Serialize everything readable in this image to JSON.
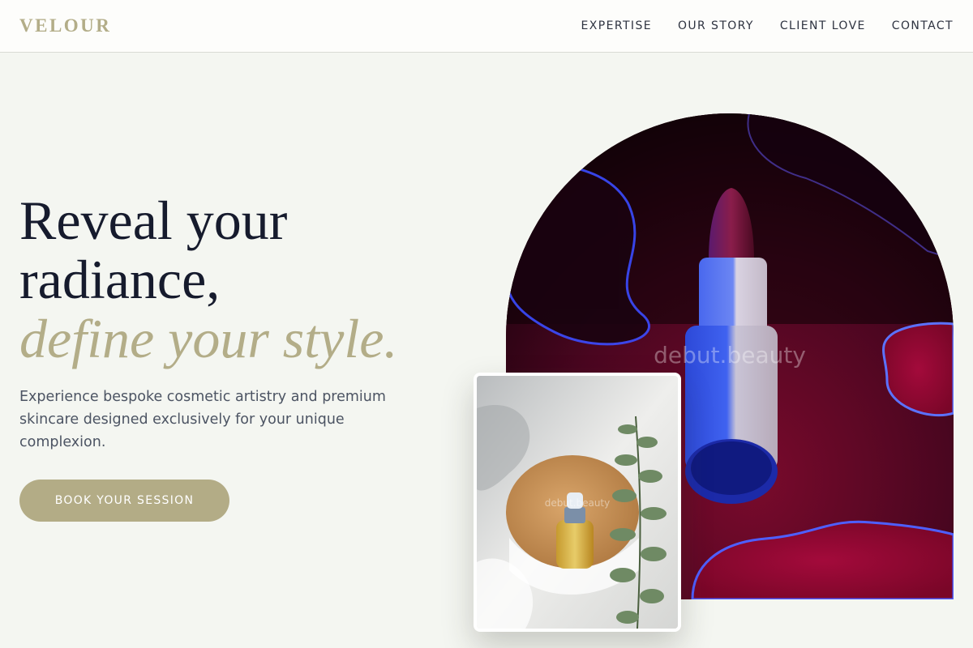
{
  "brand": {
    "name": "VELOUR",
    "color": "#b3ad88"
  },
  "nav": {
    "items": [
      {
        "label": "EXPERTISE"
      },
      {
        "label": "OUR STORY"
      },
      {
        "label": "CLIENT LOVE"
      },
      {
        "label": "CONTACT"
      }
    ]
  },
  "hero": {
    "title_line1": "Reveal your",
    "title_line2": "radiance,",
    "title_accent": "define your style.",
    "subtitle": "Experience bespoke cosmetic artistry and premium skincare designed exclusively for your unique complexion.",
    "cta_label": "BOOK YOUR SESSION"
  },
  "images": {
    "main_watermark": "debut.beauty",
    "card_watermark": "debut.beauty"
  },
  "colors": {
    "accent": "#b3ad88",
    "background": "#f4f6f1",
    "heading": "#161b2d"
  }
}
